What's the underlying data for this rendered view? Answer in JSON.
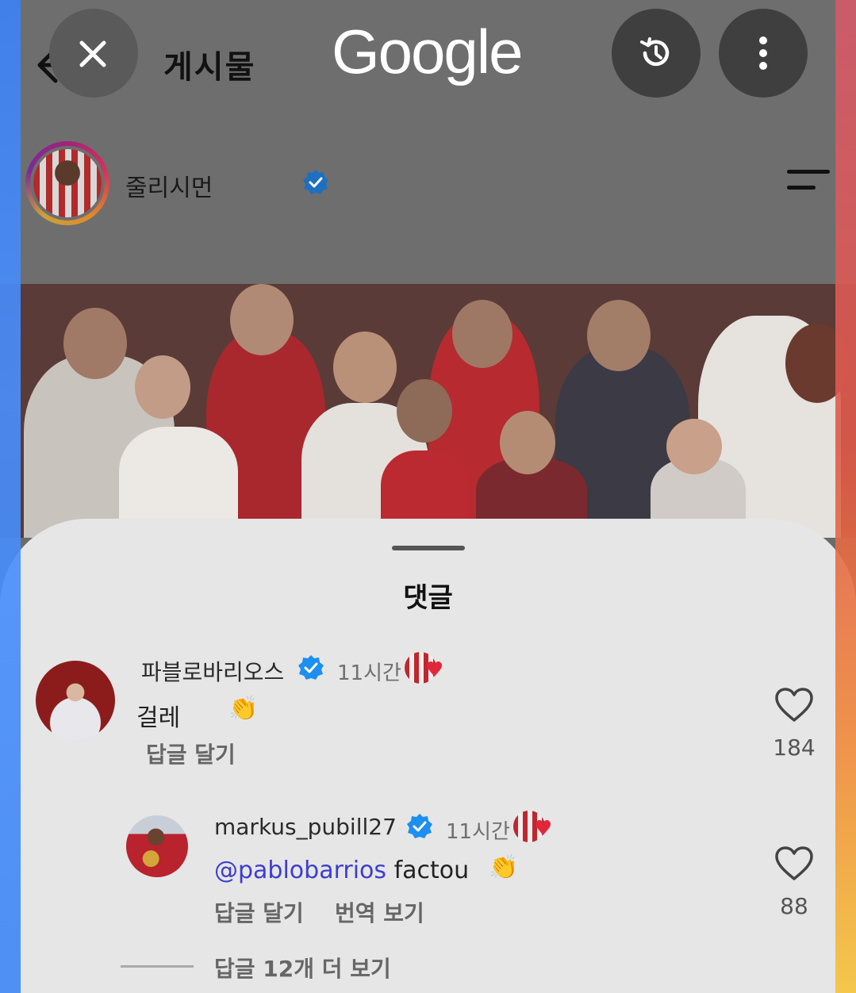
{
  "header": {
    "title": "게시물",
    "username": "줄리시먼"
  },
  "google": {
    "logo_text": "Google",
    "close_icon": "close-icon",
    "history_icon": "history-icon",
    "more_icon": "more-vert-icon"
  },
  "sheet": {
    "title": "댓글"
  },
  "comments": [
    {
      "user": "파블로바리오스",
      "time": "11시간",
      "text": "걸레",
      "emoji": "👏",
      "reply_label": "답글 달기",
      "likes": "184"
    },
    {
      "user": "markus_pubill27",
      "time": "11시간",
      "mention": "@pablobarrios",
      "text": " factou",
      "emoji": "👏",
      "reply_label": "답글 달기",
      "translate_label": "번역 보기",
      "likes": "88"
    }
  ],
  "more_replies": "답글 12개 더 보기",
  "colors": {
    "verified": "#1d8ff0",
    "mention": "#3d3dd0",
    "heart": "#e0283a"
  }
}
